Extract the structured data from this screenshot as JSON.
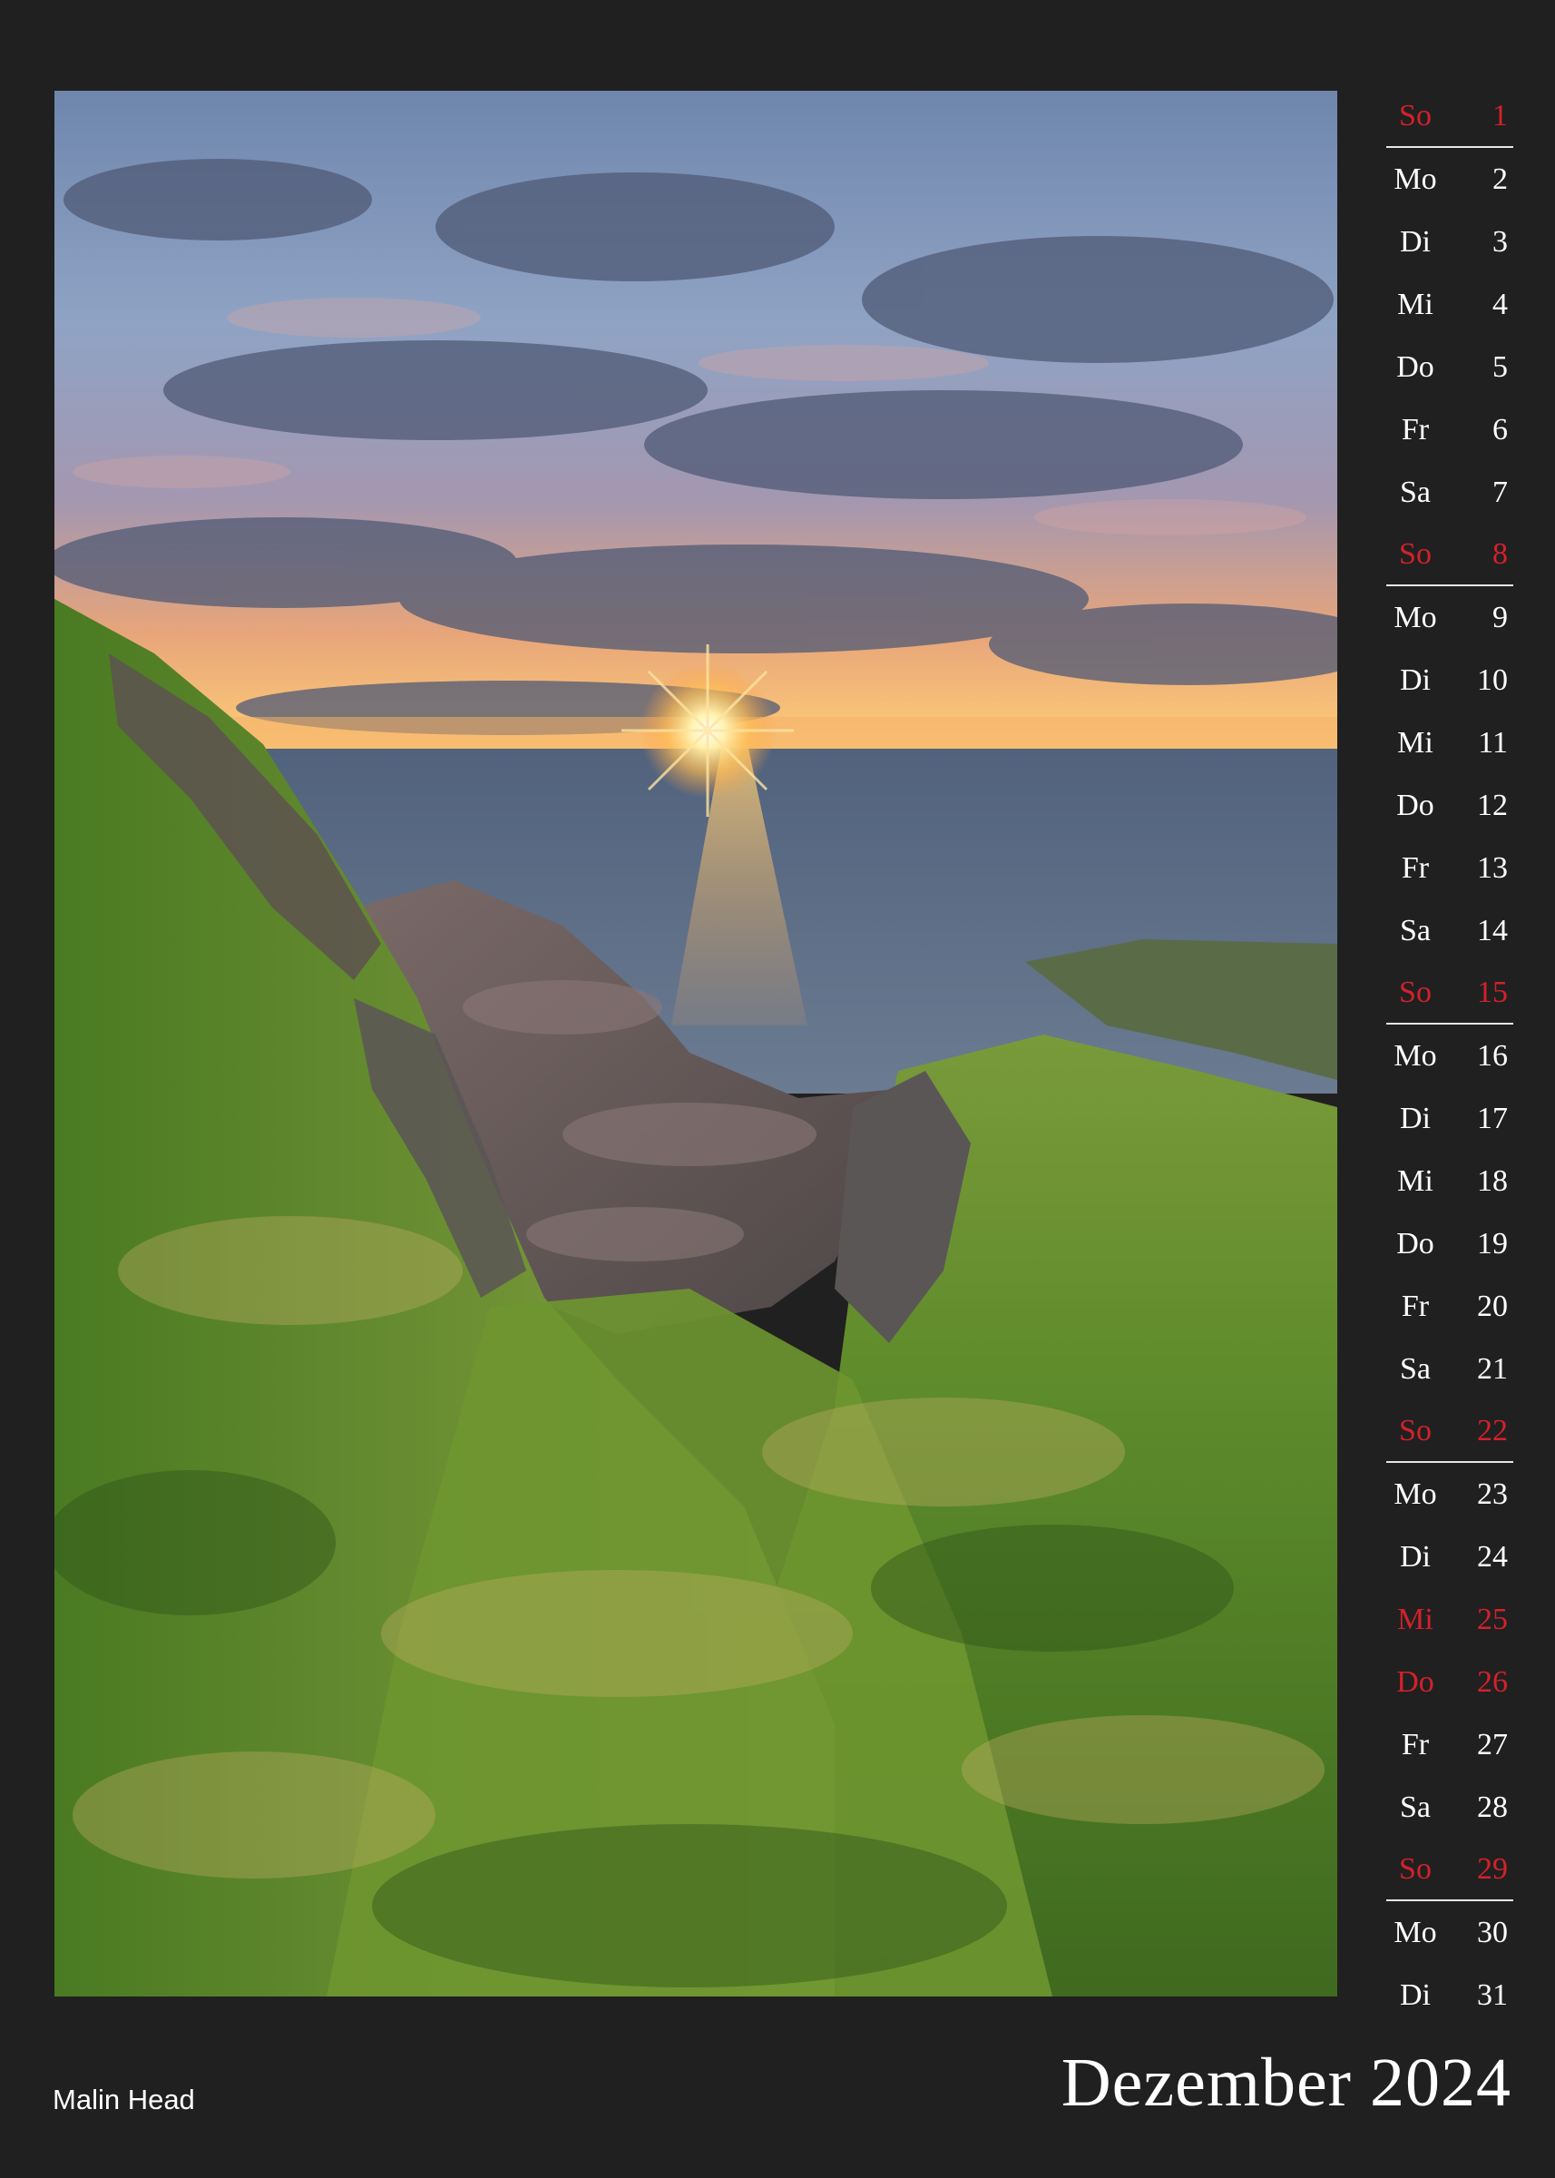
{
  "month_title": "Dezember 2024",
  "photo_caption": "Malin Head",
  "colors": {
    "background": "#202020",
    "text": "#ffffff",
    "holiday": "#d3212b"
  },
  "days": [
    {
      "weekday": "So",
      "day": "1",
      "holiday": true,
      "week_end": true
    },
    {
      "weekday": "Mo",
      "day": "2",
      "holiday": false,
      "week_end": false
    },
    {
      "weekday": "Di",
      "day": "3",
      "holiday": false,
      "week_end": false
    },
    {
      "weekday": "Mi",
      "day": "4",
      "holiday": false,
      "week_end": false
    },
    {
      "weekday": "Do",
      "day": "5",
      "holiday": false,
      "week_end": false
    },
    {
      "weekday": "Fr",
      "day": "6",
      "holiday": false,
      "week_end": false
    },
    {
      "weekday": "Sa",
      "day": "7",
      "holiday": false,
      "week_end": false
    },
    {
      "weekday": "So",
      "day": "8",
      "holiday": true,
      "week_end": true
    },
    {
      "weekday": "Mo",
      "day": "9",
      "holiday": false,
      "week_end": false
    },
    {
      "weekday": "Di",
      "day": "10",
      "holiday": false,
      "week_end": false
    },
    {
      "weekday": "Mi",
      "day": "11",
      "holiday": false,
      "week_end": false
    },
    {
      "weekday": "Do",
      "day": "12",
      "holiday": false,
      "week_end": false
    },
    {
      "weekday": "Fr",
      "day": "13",
      "holiday": false,
      "week_end": false
    },
    {
      "weekday": "Sa",
      "day": "14",
      "holiday": false,
      "week_end": false
    },
    {
      "weekday": "So",
      "day": "15",
      "holiday": true,
      "week_end": true
    },
    {
      "weekday": "Mo",
      "day": "16",
      "holiday": false,
      "week_end": false
    },
    {
      "weekday": "Di",
      "day": "17",
      "holiday": false,
      "week_end": false
    },
    {
      "weekday": "Mi",
      "day": "18",
      "holiday": false,
      "week_end": false
    },
    {
      "weekday": "Do",
      "day": "19",
      "holiday": false,
      "week_end": false
    },
    {
      "weekday": "Fr",
      "day": "20",
      "holiday": false,
      "week_end": false
    },
    {
      "weekday": "Sa",
      "day": "21",
      "holiday": false,
      "week_end": false
    },
    {
      "weekday": "So",
      "day": "22",
      "holiday": true,
      "week_end": true
    },
    {
      "weekday": "Mo",
      "day": "23",
      "holiday": false,
      "week_end": false
    },
    {
      "weekday": "Di",
      "day": "24",
      "holiday": false,
      "week_end": false
    },
    {
      "weekday": "Mi",
      "day": "25",
      "holiday": true,
      "week_end": false
    },
    {
      "weekday": "Do",
      "day": "26",
      "holiday": true,
      "week_end": false
    },
    {
      "weekday": "Fr",
      "day": "27",
      "holiday": false,
      "week_end": false
    },
    {
      "weekday": "Sa",
      "day": "28",
      "holiday": false,
      "week_end": false
    },
    {
      "weekday": "So",
      "day": "29",
      "holiday": true,
      "week_end": true
    },
    {
      "weekday": "Mo",
      "day": "30",
      "holiday": false,
      "week_end": false
    },
    {
      "weekday": "Di",
      "day": "31",
      "holiday": false,
      "week_end": false
    }
  ]
}
